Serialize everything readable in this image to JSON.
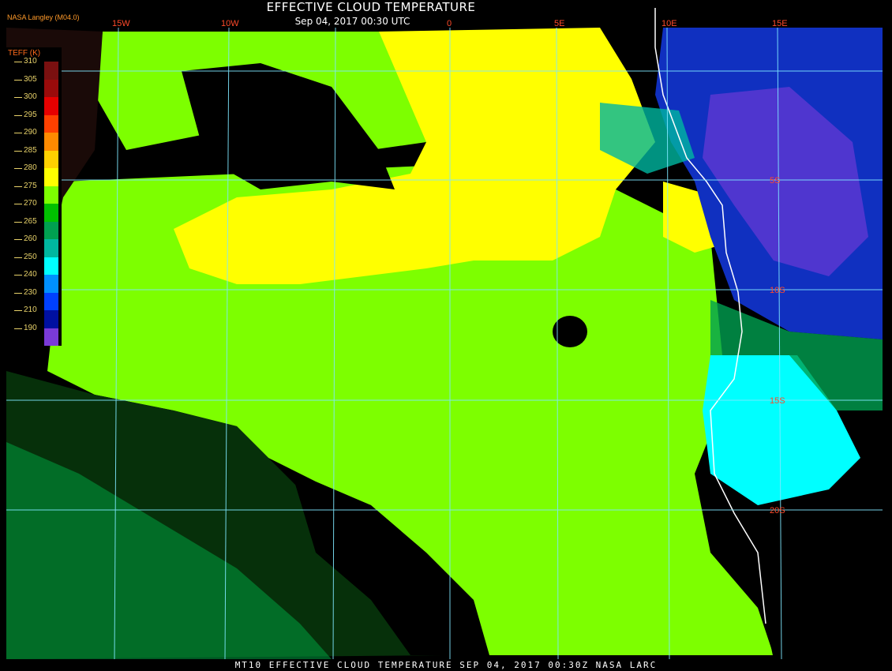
{
  "header": {
    "title": "EFFECTIVE CLOUD TEMPERATURE",
    "subtitle": "Sep 04, 2017 00:30 UTC",
    "agency": "NASA Langley (M04.0)"
  },
  "legend": {
    "label": "TEFF (K)",
    "items": [
      {
        "value": "310",
        "color": "#7a1010"
      },
      {
        "value": "305",
        "color": "#9a0b0b"
      },
      {
        "value": "300",
        "color": "#e60000"
      },
      {
        "value": "295",
        "color": "#ff4000"
      },
      {
        "value": "290",
        "color": "#ff8a00"
      },
      {
        "value": "285",
        "color": "#ffd000"
      },
      {
        "value": "280",
        "color": "#ffff00"
      },
      {
        "value": "275",
        "color": "#7dff00"
      },
      {
        "value": "270",
        "color": "#00c000"
      },
      {
        "value": "265",
        "color": "#00a050"
      },
      {
        "value": "260",
        "color": "#00b7a0"
      },
      {
        "value": "250",
        "color": "#00ffff"
      },
      {
        "value": "240",
        "color": "#0090ff"
      },
      {
        "value": "230",
        "color": "#0040ff"
      },
      {
        "value": "210",
        "color": "#0010a0"
      },
      {
        "value": "190",
        "color": "#7a3ad8"
      }
    ]
  },
  "graticule": {
    "longitudes": [
      "15W",
      "10W",
      "0",
      "5E",
      "10E",
      "15E"
    ],
    "latitudes": [
      "5S",
      "10S",
      "15S",
      "20S"
    ]
  },
  "footer": {
    "text": "MT10  EFFECTIVE CLOUD TEMPERATURE  SEP 04, 2017 00:30Z  NASA LARC"
  },
  "colors": {
    "grid": "#7fe8ff",
    "coast": "#ffffff",
    "clear": "#000000"
  }
}
